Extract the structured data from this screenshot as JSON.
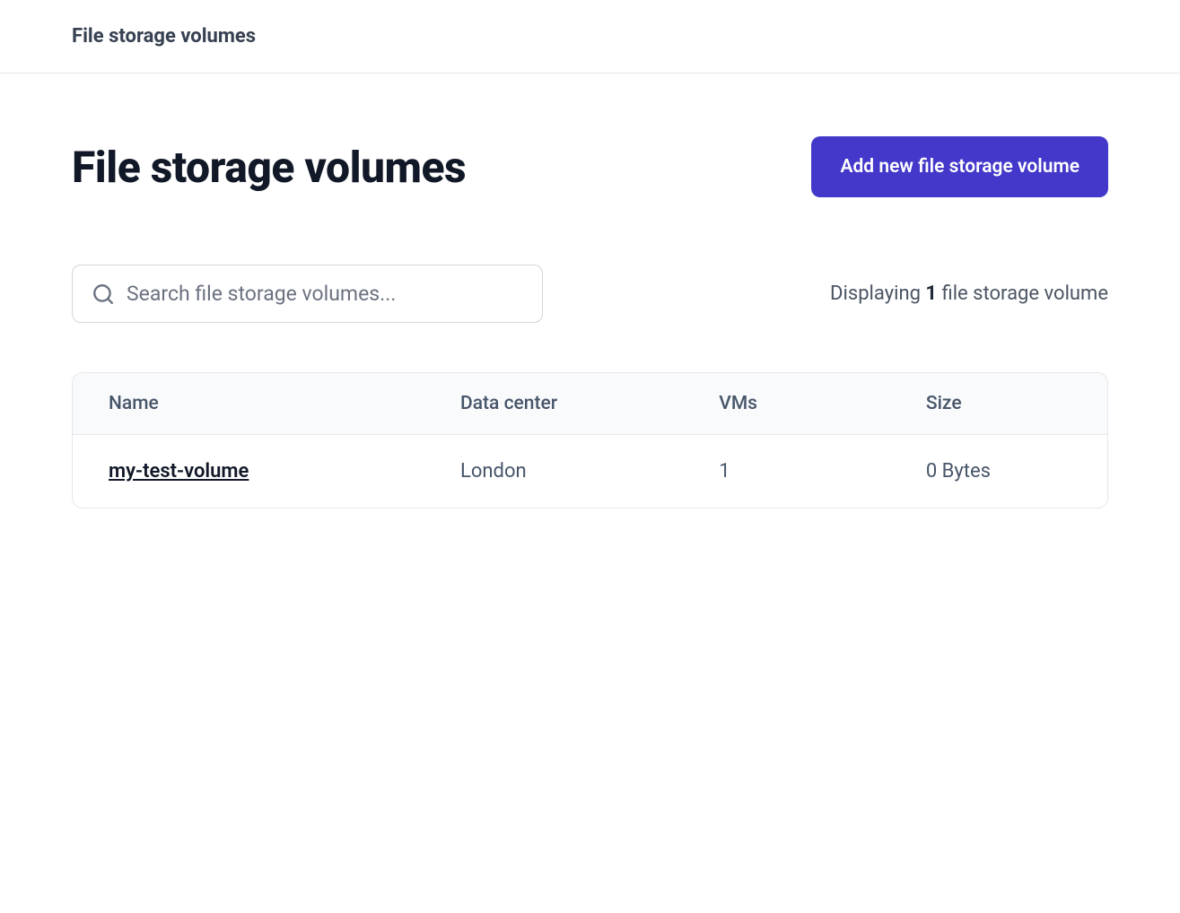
{
  "topbar": {
    "title": "File storage volumes"
  },
  "header": {
    "title": "File storage volumes",
    "add_button_label": "Add new file storage volume"
  },
  "search": {
    "placeholder": "Search file storage volumes..."
  },
  "status": {
    "prefix": "Displaying ",
    "count": "1",
    "suffix": " file storage volume"
  },
  "table": {
    "columns": {
      "name": "Name",
      "datacenter": "Data center",
      "vms": "VMs",
      "size": "Size"
    },
    "rows": [
      {
        "name": "my-test-volume",
        "datacenter": "London",
        "vms": "1",
        "size": "0 Bytes"
      }
    ]
  }
}
